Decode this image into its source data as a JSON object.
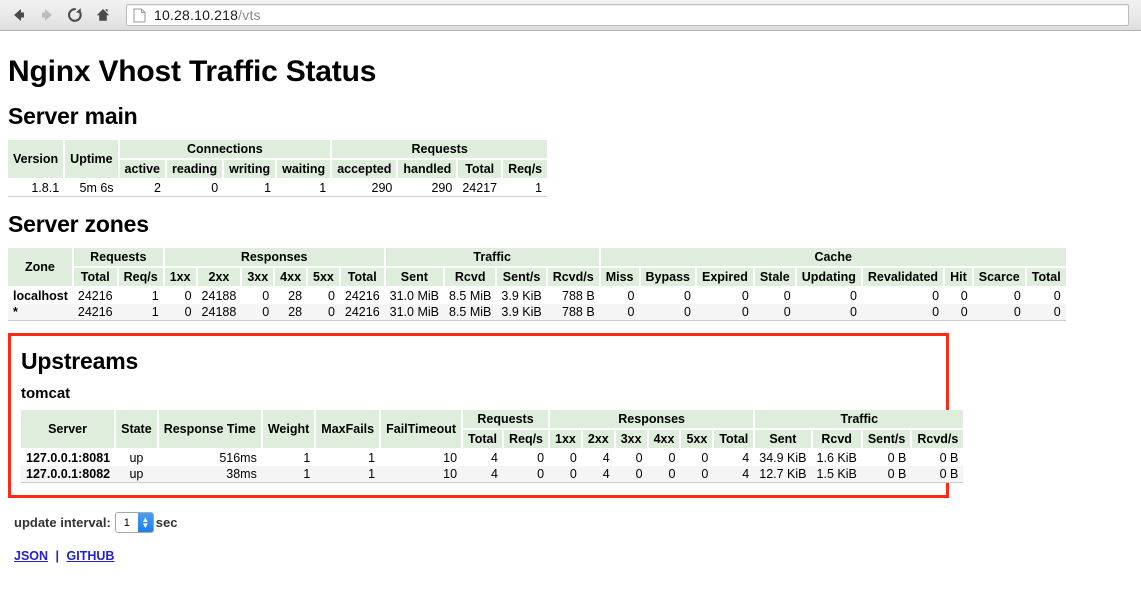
{
  "browser": {
    "back_icon": "back-arrow-icon",
    "forward_icon": "forward-arrow-icon",
    "reload_icon": "reload-icon",
    "home_icon": "home-icon",
    "page_icon": "document-icon",
    "url_host": "10.28.10.218",
    "url_path": "/vts"
  },
  "page": {
    "title": "Nginx Vhost Traffic Status"
  },
  "server_main": {
    "title": "Server main",
    "group_headers": {
      "connections": "Connections",
      "requests": "Requests"
    },
    "headers": {
      "version": "Version",
      "uptime": "Uptime",
      "active": "active",
      "reading": "reading",
      "writing": "writing",
      "waiting": "waiting",
      "accepted": "accepted",
      "handled": "handled",
      "total": "Total",
      "reqs": "Req/s"
    },
    "row": {
      "version": "1.8.1",
      "uptime": "5m 6s",
      "active": "2",
      "reading": "0",
      "writing": "1",
      "waiting": "1",
      "accepted": "290",
      "handled": "290",
      "total": "24217",
      "reqs": "1"
    }
  },
  "server_zones": {
    "title": "Server zones",
    "group_headers": {
      "zone": "Zone",
      "requests": "Requests",
      "responses": "Responses",
      "traffic": "Traffic",
      "cache": "Cache"
    },
    "headers": {
      "req_total": "Total",
      "req_reqs": "Req/s",
      "r1xx": "1xx",
      "r2xx": "2xx",
      "r3xx": "3xx",
      "r4xx": "4xx",
      "r5xx": "5xx",
      "resp_total": "Total",
      "sent": "Sent",
      "rcvd": "Rcvd",
      "sent_s": "Sent/s",
      "rcvd_s": "Rcvd/s",
      "miss": "Miss",
      "bypass": "Bypass",
      "expired": "Expired",
      "stale": "Stale",
      "updating": "Updating",
      "revalidated": "Revalidated",
      "hit": "Hit",
      "scarce": "Scarce",
      "cache_total": "Total"
    },
    "rows": [
      {
        "zone": "localhost",
        "req_total": "24216",
        "req_reqs": "1",
        "r1xx": "0",
        "r2xx": "24188",
        "r3xx": "0",
        "r4xx": "28",
        "r5xx": "0",
        "resp_total": "24216",
        "sent": "31.0 MiB",
        "rcvd": "8.5 MiB",
        "sent_s": "3.9 KiB",
        "rcvd_s": "788 B",
        "miss": "0",
        "bypass": "0",
        "expired": "0",
        "stale": "0",
        "updating": "0",
        "revalidated": "0",
        "hit": "0",
        "scarce": "0",
        "cache_total": "0"
      },
      {
        "zone": "*",
        "req_total": "24216",
        "req_reqs": "1",
        "r1xx": "0",
        "r2xx": "24188",
        "r3xx": "0",
        "r4xx": "28",
        "r5xx": "0",
        "resp_total": "24216",
        "sent": "31.0 MiB",
        "rcvd": "8.5 MiB",
        "sent_s": "3.9 KiB",
        "rcvd_s": "788 B",
        "miss": "0",
        "bypass": "0",
        "expired": "0",
        "stale": "0",
        "updating": "0",
        "revalidated": "0",
        "hit": "0",
        "scarce": "0",
        "cache_total": "0"
      }
    ]
  },
  "upstreams": {
    "title": "Upstreams",
    "highlight_color": "#fb2b15",
    "group_name": "tomcat",
    "group_headers": {
      "server": "Server",
      "state": "State",
      "response_time": "Response Time",
      "weight": "Weight",
      "maxfails": "MaxFails",
      "failtimeout": "FailTimeout",
      "requests": "Requests",
      "responses": "Responses",
      "traffic": "Traffic"
    },
    "headers": {
      "req_total": "Total",
      "req_reqs": "Req/s",
      "r1xx": "1xx",
      "r2xx": "2xx",
      "r3xx": "3xx",
      "r4xx": "4xx",
      "r5xx": "5xx",
      "resp_total": "Total",
      "sent": "Sent",
      "rcvd": "Rcvd",
      "sent_s": "Sent/s",
      "rcvd_s": "Rcvd/s"
    },
    "rows": [
      {
        "server": "127.0.0.1:8081",
        "state": "up",
        "response_time": "516ms",
        "weight": "1",
        "maxfails": "1",
        "failtimeout": "10",
        "req_total": "4",
        "req_reqs": "0",
        "r1xx": "0",
        "r2xx": "4",
        "r3xx": "0",
        "r4xx": "0",
        "r5xx": "0",
        "resp_total": "4",
        "sent": "34.9 KiB",
        "rcvd": "1.6 KiB",
        "sent_s": "0 B",
        "rcvd_s": "0 B"
      },
      {
        "server": "127.0.0.1:8082",
        "state": "up",
        "response_time": "38ms",
        "weight": "1",
        "maxfails": "1",
        "failtimeout": "10",
        "req_total": "4",
        "req_reqs": "0",
        "r1xx": "0",
        "r2xx": "4",
        "r3xx": "0",
        "r4xx": "0",
        "r5xx": "0",
        "resp_total": "4",
        "sent": "12.7 KiB",
        "rcvd": "1.5 KiB",
        "sent_s": "0 B",
        "rcvd_s": "0 B"
      }
    ]
  },
  "footer": {
    "update_label": "update interval:",
    "update_value": "1",
    "sec_label": "sec",
    "json_link": "JSON",
    "separator": "|",
    "github_link": "GITHUB"
  }
}
